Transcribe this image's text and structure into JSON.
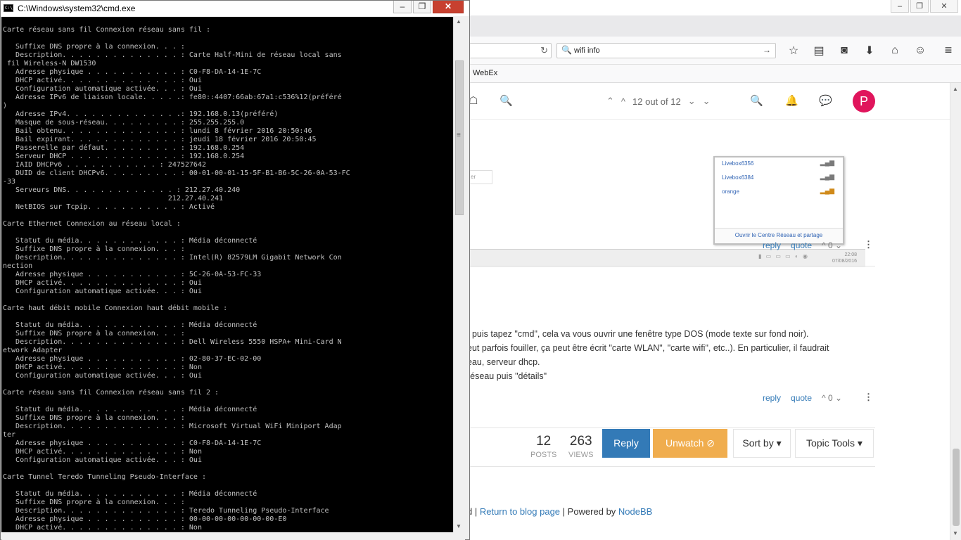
{
  "cmd": {
    "title": "C:\\Windows\\system32\\cmd.exe",
    "icon_label": "C:\\",
    "buttons": {
      "minimize": "–",
      "maximize": "❐",
      "close": "✕"
    },
    "lines": [
      "Carte réseau sans fil Connexion réseau sans fil :",
      "",
      "   Suffixe DNS propre à la connexion. . . :",
      "   Description. . . . . . . . . . . . . . : Carte Half-Mini de réseau local sans",
      " fil Wireless-N DW1530",
      "   Adresse physique . . . . . . . . . . . : C0-F8-DA-14-1E-7C",
      "   DHCP activé. . . . . . . . . . . . . . : Oui",
      "   Configuration automatique activée. . . : Oui",
      "   Adresse IPv6 de liaison locale. . . . .: fe80::4407:66ab:67a1:c536%12(préféré",
      ")",
      "   Adresse IPv4. . . . . . . . . . . . . .: 192.168.0.13(préféré)",
      "   Masque de sous-réseau. . . . . . . . . : 255.255.255.0",
      "   Bail obtenu. . . . . . . . . . . . . . : lundi 8 février 2016 20:50:46",
      "   Bail expirant. . . . . . . . . . . . . : jeudi 18 février 2016 20:50:45",
      "   Passerelle par défaut. . . . . . . . . : 192.168.0.254",
      "   Serveur DHCP . . . . . . . . . . . . . : 192.168.0.254",
      "   IAID DHCPv6 . . . . . . . . . . . : 247527642",
      "   DUID de client DHCPv6. . . . . . . . . : 00-01-00-01-15-5F-B1-B6-5C-26-0A-53-FC",
      "-33",
      "   Serveurs DNS. . . . . . . . . . . . . : 212.27.40.240",
      "                                       212.27.40.241",
      "   NetBIOS sur Tcpip. . . . . . . . . . . : Activé",
      "",
      "Carte Ethernet Connexion au réseau local :",
      "",
      "   Statut du média. . . . . . . . . . . . : Média déconnecté",
      "   Suffixe DNS propre à la connexion. . . :",
      "   Description. . . . . . . . . . . . . . : Intel(R) 82579LM Gigabit Network Con",
      "nection",
      "   Adresse physique . . . . . . . . . . . : 5C-26-0A-53-FC-33",
      "   DHCP activé. . . . . . . . . . . . . . : Oui",
      "   Configuration automatique activée. . . : Oui",
      "",
      "Carte haut débit mobile Connexion haut débit mobile :",
      "",
      "   Statut du média. . . . . . . . . . . . : Média déconnecté",
      "   Suffixe DNS propre à la connexion. . . :",
      "   Description. . . . . . . . . . . . . . : Dell Wireless 5550 HSPA+ Mini-Card N",
      "etwork Adapter",
      "   Adresse physique . . . . . . . . . . . : 02-80-37-EC-02-00",
      "   DHCP activé. . . . . . . . . . . . . . : Non",
      "   Configuration automatique activée. . . : Oui",
      "",
      "Carte réseau sans fil Connexion réseau sans fil 2 :",
      "",
      "   Statut du média. . . . . . . . . . . . : Média déconnecté",
      "   Suffixe DNS propre à la connexion. . . :",
      "   Description. . . . . . . . . . . . . . : Microsoft Virtual WiFi Miniport Adap",
      "ter",
      "   Adresse physique . . . . . . . . . . . : C0-F8-DA-14-1E-7C",
      "   DHCP activé. . . . . . . . . . . . . . : Non",
      "   Configuration automatique activée. . . : Oui",
      "",
      "Carte Tunnel Teredo Tunneling Pseudo-Interface :",
      "",
      "   Statut du média. . . . . . . . . . . . : Média déconnecté",
      "   Suffixe DNS propre à la connexion. . . :",
      "   Description. . . . . . . . . . . . . . : Teredo Tunneling Pseudo-Interface",
      "   Adresse physique . . . . . . . . . . . : 00-00-00-00-00-00-00-E0",
      "   DHCP activé. . . . . . . . . . . . . . : Non"
    ]
  },
  "browser": {
    "window_buttons": {
      "minimize": "–",
      "maximize": "❐",
      "close": "✕"
    },
    "reload_icon": "↻",
    "search": {
      "icon": "🔍",
      "value": "wifi info",
      "go": "→"
    },
    "toolbar_icons": [
      "☆",
      "▤",
      "◙",
      "⬇",
      "⌂",
      "☺"
    ],
    "menu_icon": "≡",
    "bookmark": "WebEx",
    "page": {
      "header": {
        "chat_icon": "☖",
        "search_icon": "🔍",
        "pager": {
          "first": "⌃",
          "prev": "^",
          "text": "12 out of 12",
          "next": "⌄",
          "last": "⌄"
        },
        "search2_icon": "🔍",
        "bell_icon": "🔔",
        "comment_icon": "💬",
        "avatar_letter": "P"
      },
      "wifi_screenshot": {
        "networks": [
          "Livebox6356",
          "Livebox6384",
          "orange"
        ],
        "link": "Ouvrir le Centre Réseau et partage",
        "input_text": "er",
        "clock": [
          "22:08",
          "07/08/2016"
        ]
      },
      "post_actions": {
        "reply": "reply",
        "quote": "quote",
        "votes": "^ 0 ⌄"
      },
      "post_lines": [
        ", puis tapez \"cmd\", cela va vous ouvrir une fenêtre type DOS (mode texte sur fond noir).",
        "eut parfois fouiller, ça peut être écrit \"carte WLAN\", \"carte wifi\", etc..). En particulier, il faudrait",
        "eau, serveur dhcp.",
        "réseau puis \"détails\""
      ],
      "stats": {
        "posts_num": "12",
        "posts_label": "POSTS",
        "views_num": "263",
        "views_label": "VIEWS"
      },
      "buttons": {
        "reply": "Reply",
        "unwatch": "Unwatch ⊘",
        "sort": "Sort by ▾",
        "tools": "Topic Tools ▾"
      },
      "footer": {
        "lead": "d | ",
        "return": "Return to blog page",
        "mid": " | Powered by ",
        "nodebb": "NodeBB"
      }
    }
  }
}
